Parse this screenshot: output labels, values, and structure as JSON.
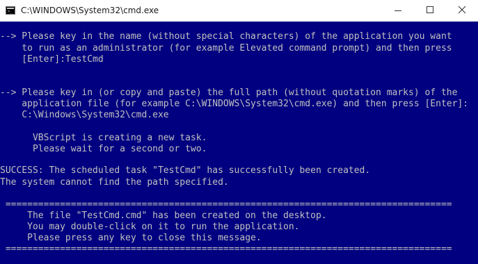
{
  "window": {
    "title": "C:\\WINDOWS\\System32\\cmd.exe",
    "console_background": "#000080",
    "console_text_color": "#c0c0c0",
    "icon": "cmd-console-icon"
  },
  "title_buttons": {
    "minimize": "minimize-icon",
    "maximize": "maximize-icon",
    "close": "close-icon"
  },
  "console": {
    "lines": [
      "--> Please key in the name (without special characters) of the application you want",
      "    to run as an administrator (for example Elevated command prompt) and then press",
      "    [Enter]:TestCmd",
      "--> Please key in (or copy and paste) the full path (without quotation marks) of the",
      "    application file (for example C:\\WINDOWS\\System32\\cmd.exe) and then press [Enter]:",
      "    C:\\Windows\\System32\\cmd.exe",
      "      VBScript is creating a new task.",
      "      Please wait for a second or two.",
      "SUCCESS: The scheduled task \"TestCmd\" has successfully been created.",
      "The system cannot find the path specified.",
      " ==================================================================================",
      "     The file \"TestCmd.cmd\" has been created on the desktop.",
      "     You may double-click on it to run the application.",
      "     Please press any key to close this message.",
      " =================================================================================="
    ]
  }
}
